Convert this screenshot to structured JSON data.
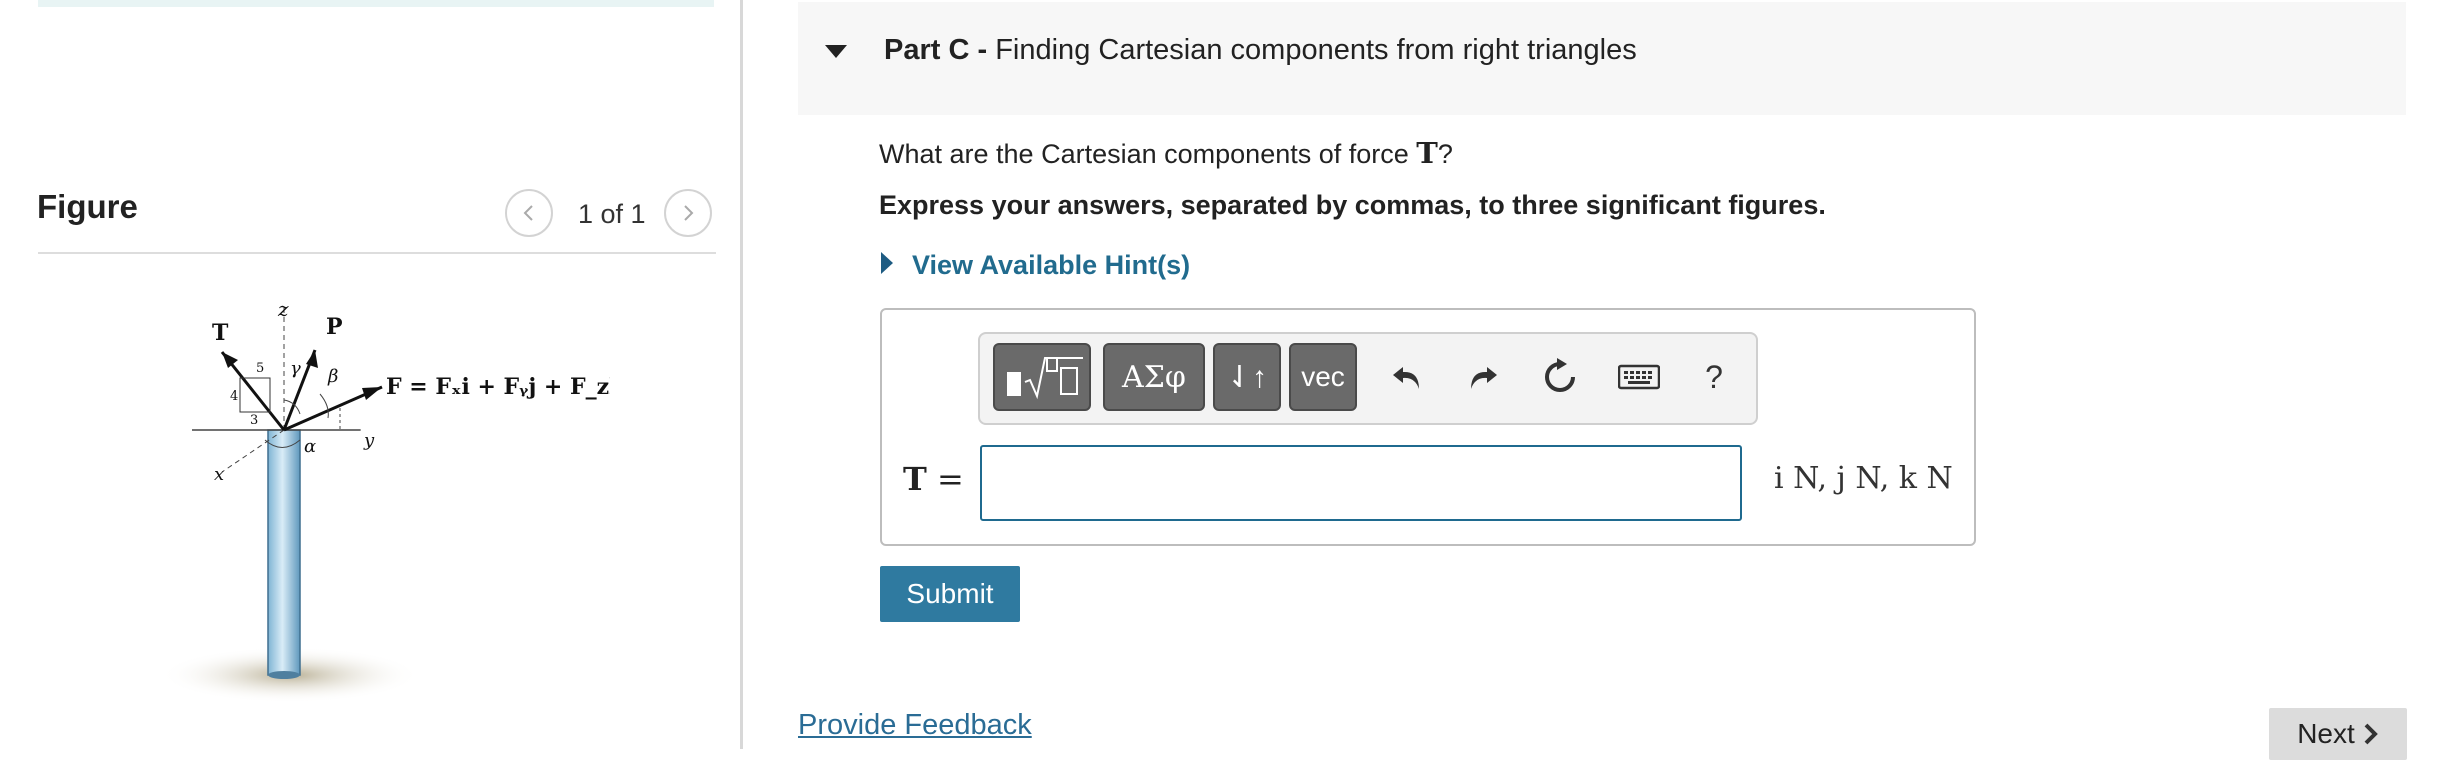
{
  "figure_panel": {
    "title": "Figure",
    "page_indicator": "1 of 1",
    "prev_icon": "chevron-left-icon",
    "next_icon": "chevron-right-icon",
    "figure_labels": {
      "T": "T",
      "z": "z",
      "P": "P",
      "gamma": "γ",
      "beta": "β",
      "alpha": "α",
      "y": "y",
      "x": "x",
      "n4": "4",
      "n5": "5",
      "n3": "3",
      "equation": "F = Fₓi + Fᵧj + F_zk"
    }
  },
  "part": {
    "label": "Part C -",
    "title": "Finding Cartesian components from right triangles",
    "caret_icon": "caret-down-icon"
  },
  "question": {
    "text_before": "What are the Cartesian components of force",
    "symbol": "T",
    "text_after": "?"
  },
  "instructions": "Express your answers, separated by commas, to three significant figures.",
  "hint": {
    "label": "View Available Hint(s)",
    "icon": "caret-right-icon"
  },
  "toolbar": {
    "templates_icon": "templates-sqrt-icon",
    "greek_label": "ΑΣφ",
    "arrows_label": "⇃↑",
    "vec_label": "vec",
    "undo_icon": "undo-icon",
    "redo_icon": "redo-icon",
    "reset_icon": "reset-icon",
    "keyboard_icon": "keyboard-icon",
    "help_label": "?"
  },
  "answer": {
    "variable": "T",
    "equals": "=",
    "value": "",
    "units": "i N, j N, k N"
  },
  "actions": {
    "submit_label": "Submit",
    "feedback_label": "Provide Feedback",
    "next_label": "Next",
    "next_icon": "chevron-right-icon"
  },
  "colors": {
    "accent": "#2f7aa0",
    "link": "#216b8e",
    "toolbar_button": "#6a6a6a",
    "input_border": "#1f6a8f"
  }
}
